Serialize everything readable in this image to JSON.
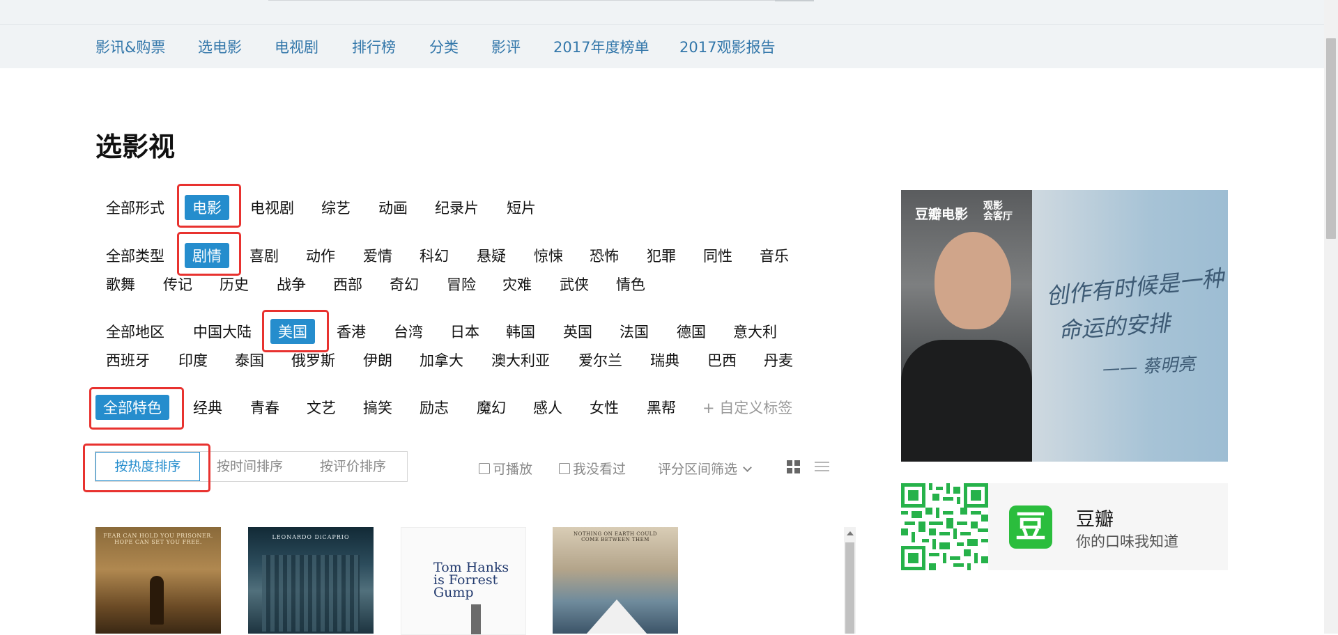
{
  "nav": {
    "items": [
      "影讯&购票",
      "选电影",
      "电视剧",
      "排行榜",
      "分类",
      "影评",
      "2017年度榜单",
      "2017观影报告"
    ]
  },
  "page": {
    "title": "选影视"
  },
  "filters": {
    "forms": [
      "全部形式",
      "电影",
      "电视剧",
      "综艺",
      "动画",
      "纪录片",
      "短片"
    ],
    "form_selected": "电影",
    "genres_row1": [
      "全部类型",
      "剧情",
      "喜剧",
      "动作",
      "爱情",
      "科幻",
      "悬疑",
      "惊悚",
      "恐怖",
      "犯罪",
      "同性",
      "音乐"
    ],
    "genres_row2": [
      "歌舞",
      "传记",
      "历史",
      "战争",
      "西部",
      "奇幻",
      "冒险",
      "灾难",
      "武侠",
      "情色"
    ],
    "genre_selected": "剧情",
    "regions_row1": [
      "全部地区",
      "中国大陆",
      "美国",
      "香港",
      "台湾",
      "日本",
      "韩国",
      "英国",
      "法国",
      "德国",
      "意大利"
    ],
    "regions_row2": [
      "西班牙",
      "印度",
      "泰国",
      "俄罗斯",
      "伊朗",
      "加拿大",
      "澳大利亚",
      "爱尔兰",
      "瑞典",
      "巴西",
      "丹麦"
    ],
    "region_selected": "美国",
    "features": [
      "全部特色",
      "经典",
      "青春",
      "文艺",
      "搞笑",
      "励志",
      "魔幻",
      "感人",
      "女性",
      "黑帮",
      "+ 自定义标签"
    ],
    "feature_selected": "全部特色"
  },
  "sort": {
    "hot": "按热度排序",
    "time": "按时间排序",
    "rating": "按评价排序",
    "active": "按热度排序"
  },
  "options": {
    "playable": "可播放",
    "unwatched": "我没看过",
    "range": "评分区间筛选"
  },
  "view_icons": [
    "grid-icon",
    "list-icon"
  ],
  "posters": [
    {
      "title": "FEAR CAN HOLD YOU PRISONER. HOPE CAN SET YOU FREE."
    },
    {
      "title": "LEONARDO DiCAPRIO"
    },
    {
      "title": "Tom Hanks is Forrest Gump"
    },
    {
      "title": "NOTHING ON EARTH COULD COME BETWEEN THEM"
    }
  ],
  "ad": {
    "brand": "豆瓣电影",
    "brand2_line1": "观影",
    "brand2_line2": "会客厅",
    "quote_line1": "创作有时候是一种",
    "quote_line2": "命运的安排",
    "quote_signature": "—— 蔡明亮"
  },
  "app": {
    "icon_char": "豆",
    "name": "豆瓣",
    "slogan": "你的口味我知道"
  },
  "colors": {
    "accent": "#258dcd",
    "nav_text": "#3377aa",
    "highlight_box": "#e8322f",
    "app_green": "#2bbd3d"
  }
}
